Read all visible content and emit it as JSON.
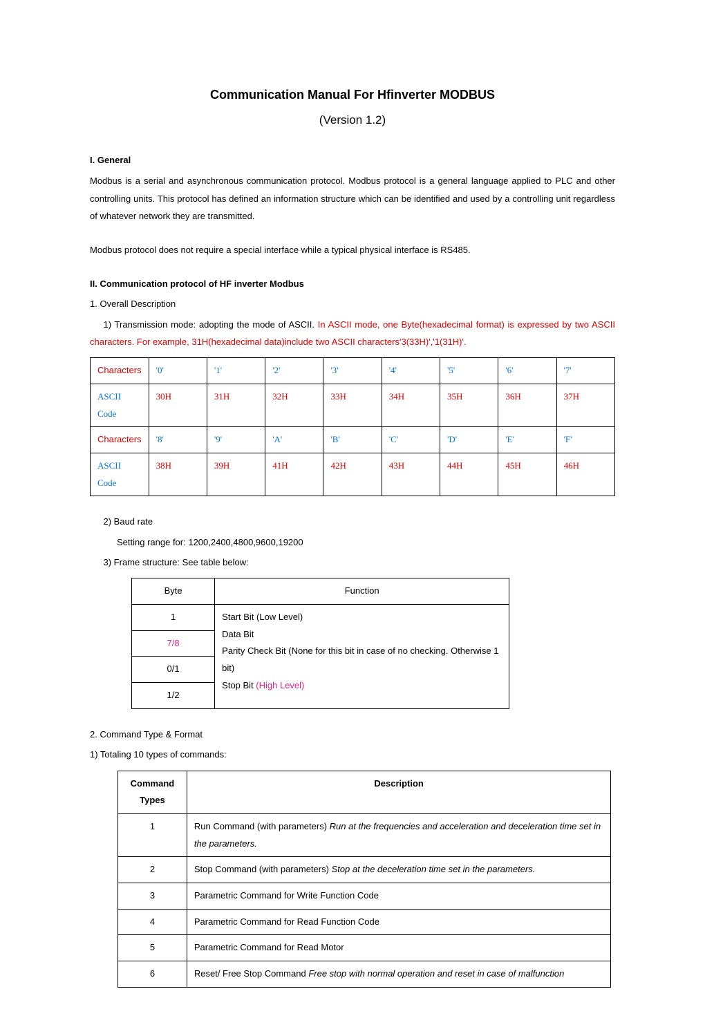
{
  "title": "Communication Manual For Hfinverter MODBUS",
  "version": "(Version 1.2)",
  "sections": {
    "general_header": "I. General",
    "general_p1": "Modbus is a serial and asynchronous communication protocol. Modbus protocol is a general language applied to PLC and other controlling units. This protocol has defined an information structure which can be identified and used by a controlling unit regardless of whatever network they are transmitted.",
    "general_p2": "Modbus protocol does not require a special interface while a typical physical interface is RS485.",
    "proto_header": "II. Communication protocol of HF inverter Modbus",
    "overall_header": "1. Overall Description",
    "transmission_prefix": "1) Transmission mode: adopting the mode of ASCII. ",
    "transmission_rev": "In ASCII mode, one Byte(hexadecimal format) is expressed by two ASCII characters.  For example, 31H(hexadecimal data)include two ASCII characters'3(33H)','1(31H)'.",
    "baud_header": "2) Baud rate",
    "baud_text": "Setting range for: 1200,2400,4800,9600,19200",
    "frame_header": "3) Frame structure: See table below:",
    "cmd_header": "2. Command Type & Format",
    "cmd_sub": "1) Totaling 10 types of commands:"
  },
  "ascii_table": {
    "row1_label": "Characters",
    "row1": [
      "'0'",
      "'1'",
      "'2'",
      "'3'",
      "'4'",
      "'5'",
      "'6'",
      "'7'"
    ],
    "row2_label": "ASCII Code",
    "row2": [
      "30H",
      "31H",
      "32H",
      "33H",
      "34H",
      "35H",
      "36H",
      "37H"
    ],
    "row3_label": "Characters",
    "row3": [
      "'8'",
      "'9'",
      "'A'",
      "'B'",
      "'C'",
      "'D'",
      "'E'",
      "'F'"
    ],
    "row4_label": "ASCII Code",
    "row4": [
      "38H",
      "39H",
      "41H",
      "42H",
      "43H",
      "44H",
      "45H",
      "46H"
    ]
  },
  "frame_table": {
    "header": [
      "Byte",
      "Function"
    ],
    "rows": [
      {
        "byte": "1",
        "func": "Start Bit (Low Level)"
      },
      {
        "byte": "7/8",
        "func": "Data Bit",
        "byte_highlight": true
      },
      {
        "byte": "0/1",
        "func_prefix": "Parity Check Bit (None for this bit in case of no checking. Otherwise 1 bit)"
      },
      {
        "byte": "1/2",
        "func_stop": "Stop Bit ",
        "func_stop_high": "(High Level)"
      }
    ]
  },
  "cmd_table": {
    "header": [
      "Command Types",
      "Description"
    ],
    "rows": [
      {
        "n": "1",
        "prefix": "Run Command (with parameters) ",
        "italic": "Run at the frequencies and acceleration and deceleration time set in the parameters."
      },
      {
        "n": "2",
        "prefix": "Stop Command (with parameters) ",
        "italic": "Stop at the deceleration time set in the parameters."
      },
      {
        "n": "3",
        "text": "Parametric Command for Write Function Code"
      },
      {
        "n": "4",
        "text": "Parametric Command for Read Function Code"
      },
      {
        "n": "5",
        "text": "Parametric Command for Read Motor"
      },
      {
        "n": "6",
        "prefix": "Reset/ Free Stop Command   ",
        "italic": "Free stop with normal operation and reset in case of malfunction"
      }
    ]
  }
}
